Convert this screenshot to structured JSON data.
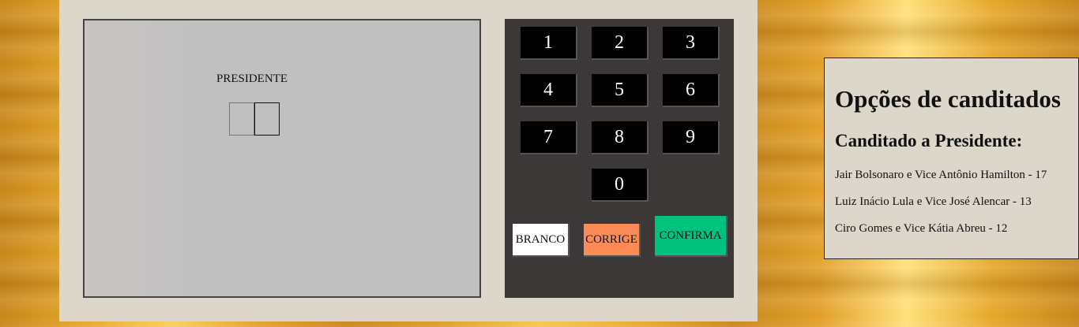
{
  "screen": {
    "office_label": "PRESIDENTE"
  },
  "keypad": {
    "keys": [
      "1",
      "2",
      "3",
      "4",
      "5",
      "6",
      "7",
      "8",
      "9",
      "0"
    ],
    "branco_label": "BRANCO",
    "corrige_label": "CORRIGE",
    "confirma_label": "CONFIRMA"
  },
  "panel": {
    "title": "Opções de canditados",
    "subtitle": "Canditado a Presidente:",
    "candidates": [
      "Jair Bolsonaro e Vice Antônio Hamilton - 17",
      "Luiz Inácio Lula e Vice José Alencar - 13",
      "Ciro Gomes e Vice Kátia Abreu - 12"
    ]
  },
  "colors": {
    "branco": "#ffffff",
    "corrige": "#fb8c57",
    "confirma": "#00c27f",
    "keypad_bg": "#3d3838",
    "key_bg": "#000000"
  }
}
